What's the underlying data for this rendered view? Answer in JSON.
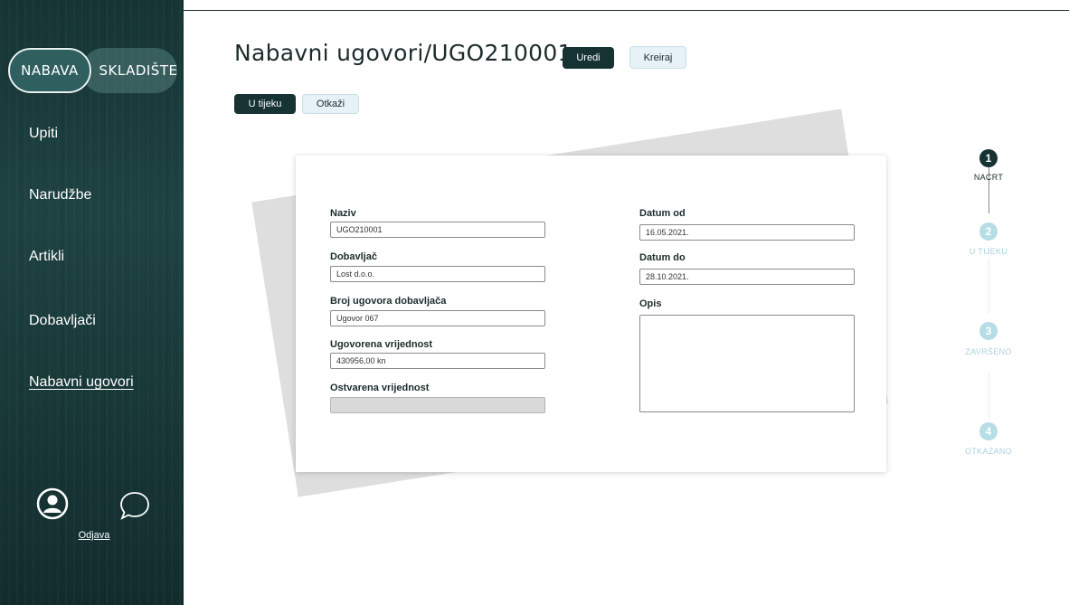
{
  "sidebar": {
    "tabs": [
      {
        "label": "NABAVA",
        "active": true
      },
      {
        "label": "SKLADIŠTE",
        "active": false
      }
    ],
    "nav": [
      {
        "label": "Upiti"
      },
      {
        "label": "Narudžbe"
      },
      {
        "label": "Artikli"
      },
      {
        "label": "Dobavljači"
      },
      {
        "label": "Nabavni ugovori",
        "active": true
      }
    ],
    "icons": [
      "user-circle-icon",
      "chat-bubble-icon"
    ],
    "logout": "Odjava"
  },
  "header": {
    "title": "Nabavni ugovori/UGO210001",
    "edit_button": "Uredi",
    "create_button": "Kreiraj"
  },
  "actions": {
    "in_progress_button": "U tijeku",
    "cancel_button": "Otkaži"
  },
  "form": {
    "naziv": {
      "label": "Naziv",
      "value": "UGO210001"
    },
    "dobavljac": {
      "label": "Dobavljač",
      "value": "Lost d.o.o."
    },
    "broj_ugovora": {
      "label": "Broj ugovora dobavljača",
      "value": "Ugovor 067"
    },
    "ugovorena": {
      "label": "Ugovorena vrijednost",
      "value": "430956,00 kn"
    },
    "ostvarena": {
      "label": "Ostvarena vrijednost",
      "value": ""
    },
    "datum_od": {
      "label": "Datum od",
      "value": "16.05.2021."
    },
    "datum_do": {
      "label": "Datum do",
      "value": "28.10.2021."
    },
    "opis": {
      "label": "Opis",
      "value": ""
    }
  },
  "stepper": [
    {
      "number": "1",
      "label": "NACRT",
      "active": true
    },
    {
      "number": "2",
      "label": "U TIJEKU",
      "active": false
    },
    {
      "number": "3",
      "label": "ZAVRŠENO",
      "active": false
    },
    {
      "number": "4",
      "label": "OTKAZANO",
      "active": false
    }
  ],
  "colors": {
    "sidebar_bg": "#173636",
    "primary_dark": "#163232",
    "light_button": "#e6f2f7",
    "step_inactive": "#b7dde6"
  }
}
